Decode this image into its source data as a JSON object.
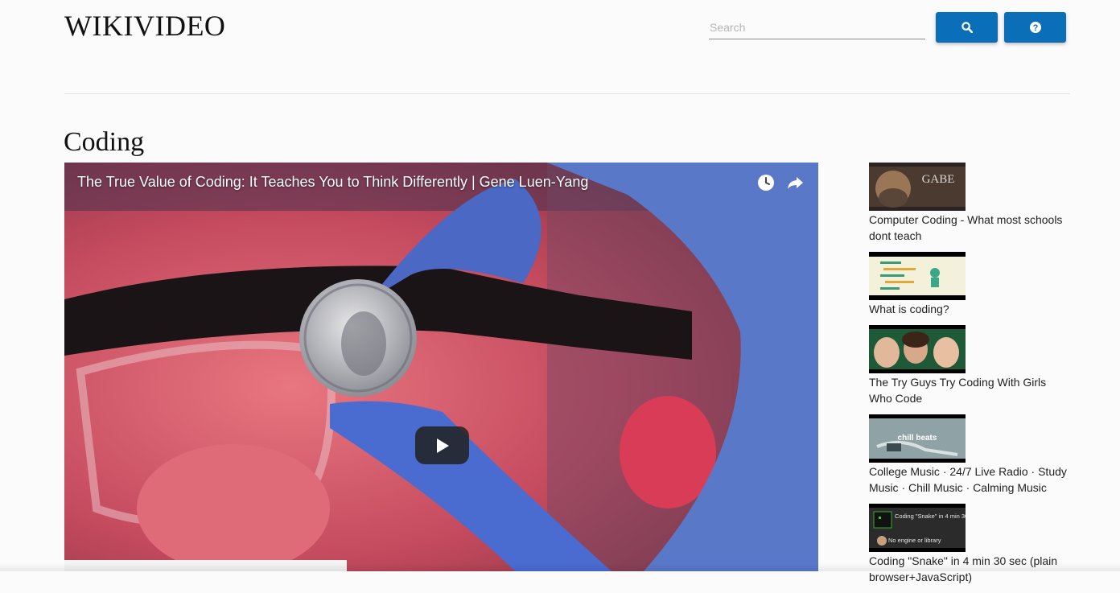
{
  "site": {
    "logo_text": "WIKIVIDEO"
  },
  "header": {
    "search_placeholder": "Search",
    "search_button_icon": "search-icon",
    "help_button_icon": "help-icon"
  },
  "page": {
    "title": "Coding"
  },
  "player": {
    "video_title": "The True Value of Coding: It Teaches You to Think Differently | Gene Luen-Yang",
    "icons": [
      "clock-icon",
      "share-icon",
      "play-icon"
    ]
  },
  "related": [
    {
      "title": "Computer Coding - What most schools dont teach",
      "thumb_text": "GABE",
      "thumb_color": "#3a2a22"
    },
    {
      "title": "What is coding?",
      "thumb_color": "#f3f1d9"
    },
    {
      "title": "The Try Guys Try Coding With Girls Who Code",
      "thumb_color": "#1f6a3a"
    },
    {
      "title": "College Music · 24/7 Live Radio · Study Music · Chill Music · Calming Music",
      "thumb_text": "chill beats",
      "thumb_color": "#8fa3a7"
    },
    {
      "title": "Coding \"Snake\" in 4 min 30 sec (plain browser+JavaScript)",
      "thumb_text": "Coding \"Snake\" in 4 min 30 sec",
      "thumb_text_2": "No engine or library",
      "thumb_color": "#2b2b2b"
    }
  ]
}
